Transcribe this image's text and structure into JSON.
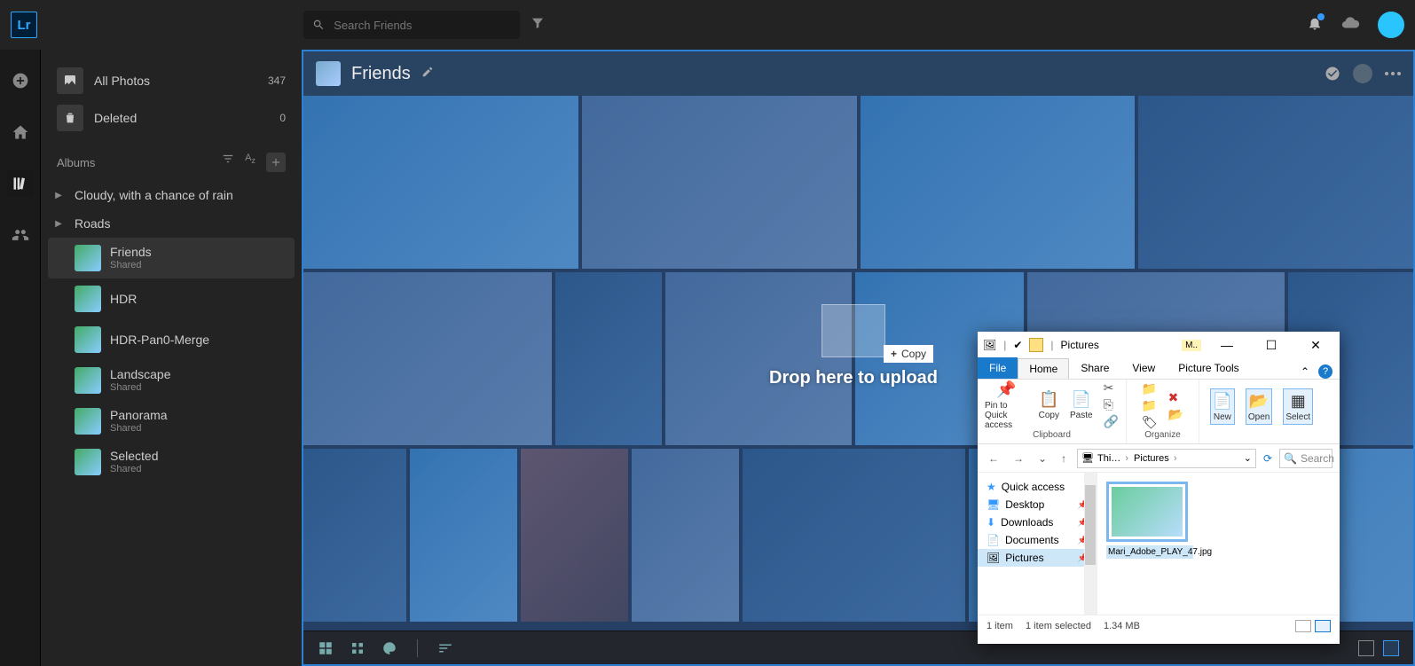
{
  "search": {
    "placeholder": "Search Friends"
  },
  "sidebar": {
    "all_photos": {
      "label": "All Photos",
      "count": "347"
    },
    "deleted": {
      "label": "Deleted",
      "count": "0"
    },
    "section": "Albums",
    "folders": [
      {
        "label": "Cloudy, with a chance of rain"
      },
      {
        "label": "Roads"
      }
    ],
    "albums": [
      {
        "label": "Friends",
        "sub": "Shared"
      },
      {
        "label": "HDR",
        "sub": ""
      },
      {
        "label": "HDR-Pan0-Merge",
        "sub": ""
      },
      {
        "label": "Landscape",
        "sub": "Shared"
      },
      {
        "label": "Panorama",
        "sub": "Shared"
      },
      {
        "label": "Selected",
        "sub": "Shared"
      }
    ]
  },
  "content": {
    "title": "Friends",
    "drop": {
      "copy": "Copy",
      "text": "Drop here to upload"
    }
  },
  "explorer": {
    "title": "Pictures",
    "badge": "M..",
    "tabs": {
      "file": "File",
      "home": "Home",
      "share": "Share",
      "view": "View",
      "pt": "Picture Tools"
    },
    "ribbon": {
      "pin": "Pin to Quick access",
      "copy": "Copy",
      "paste": "Paste",
      "clipboard_lbl": "Clipboard",
      "new": "New",
      "open": "Open",
      "select": "Select",
      "organize_lbl": "Organize"
    },
    "nav": {
      "crumb1": "Thi…",
      "crumb2": "Pictures",
      "search": "Search"
    },
    "side": {
      "quick": "Quick access",
      "desktop": "Desktop",
      "downloads": "Downloads",
      "documents": "Documents",
      "pictures": "Pictures"
    },
    "file": "Mari_Adobe_PLAY_47.jpg",
    "status": {
      "items": "1 item",
      "selected": "1 item selected",
      "size": "1.34 MB"
    }
  }
}
